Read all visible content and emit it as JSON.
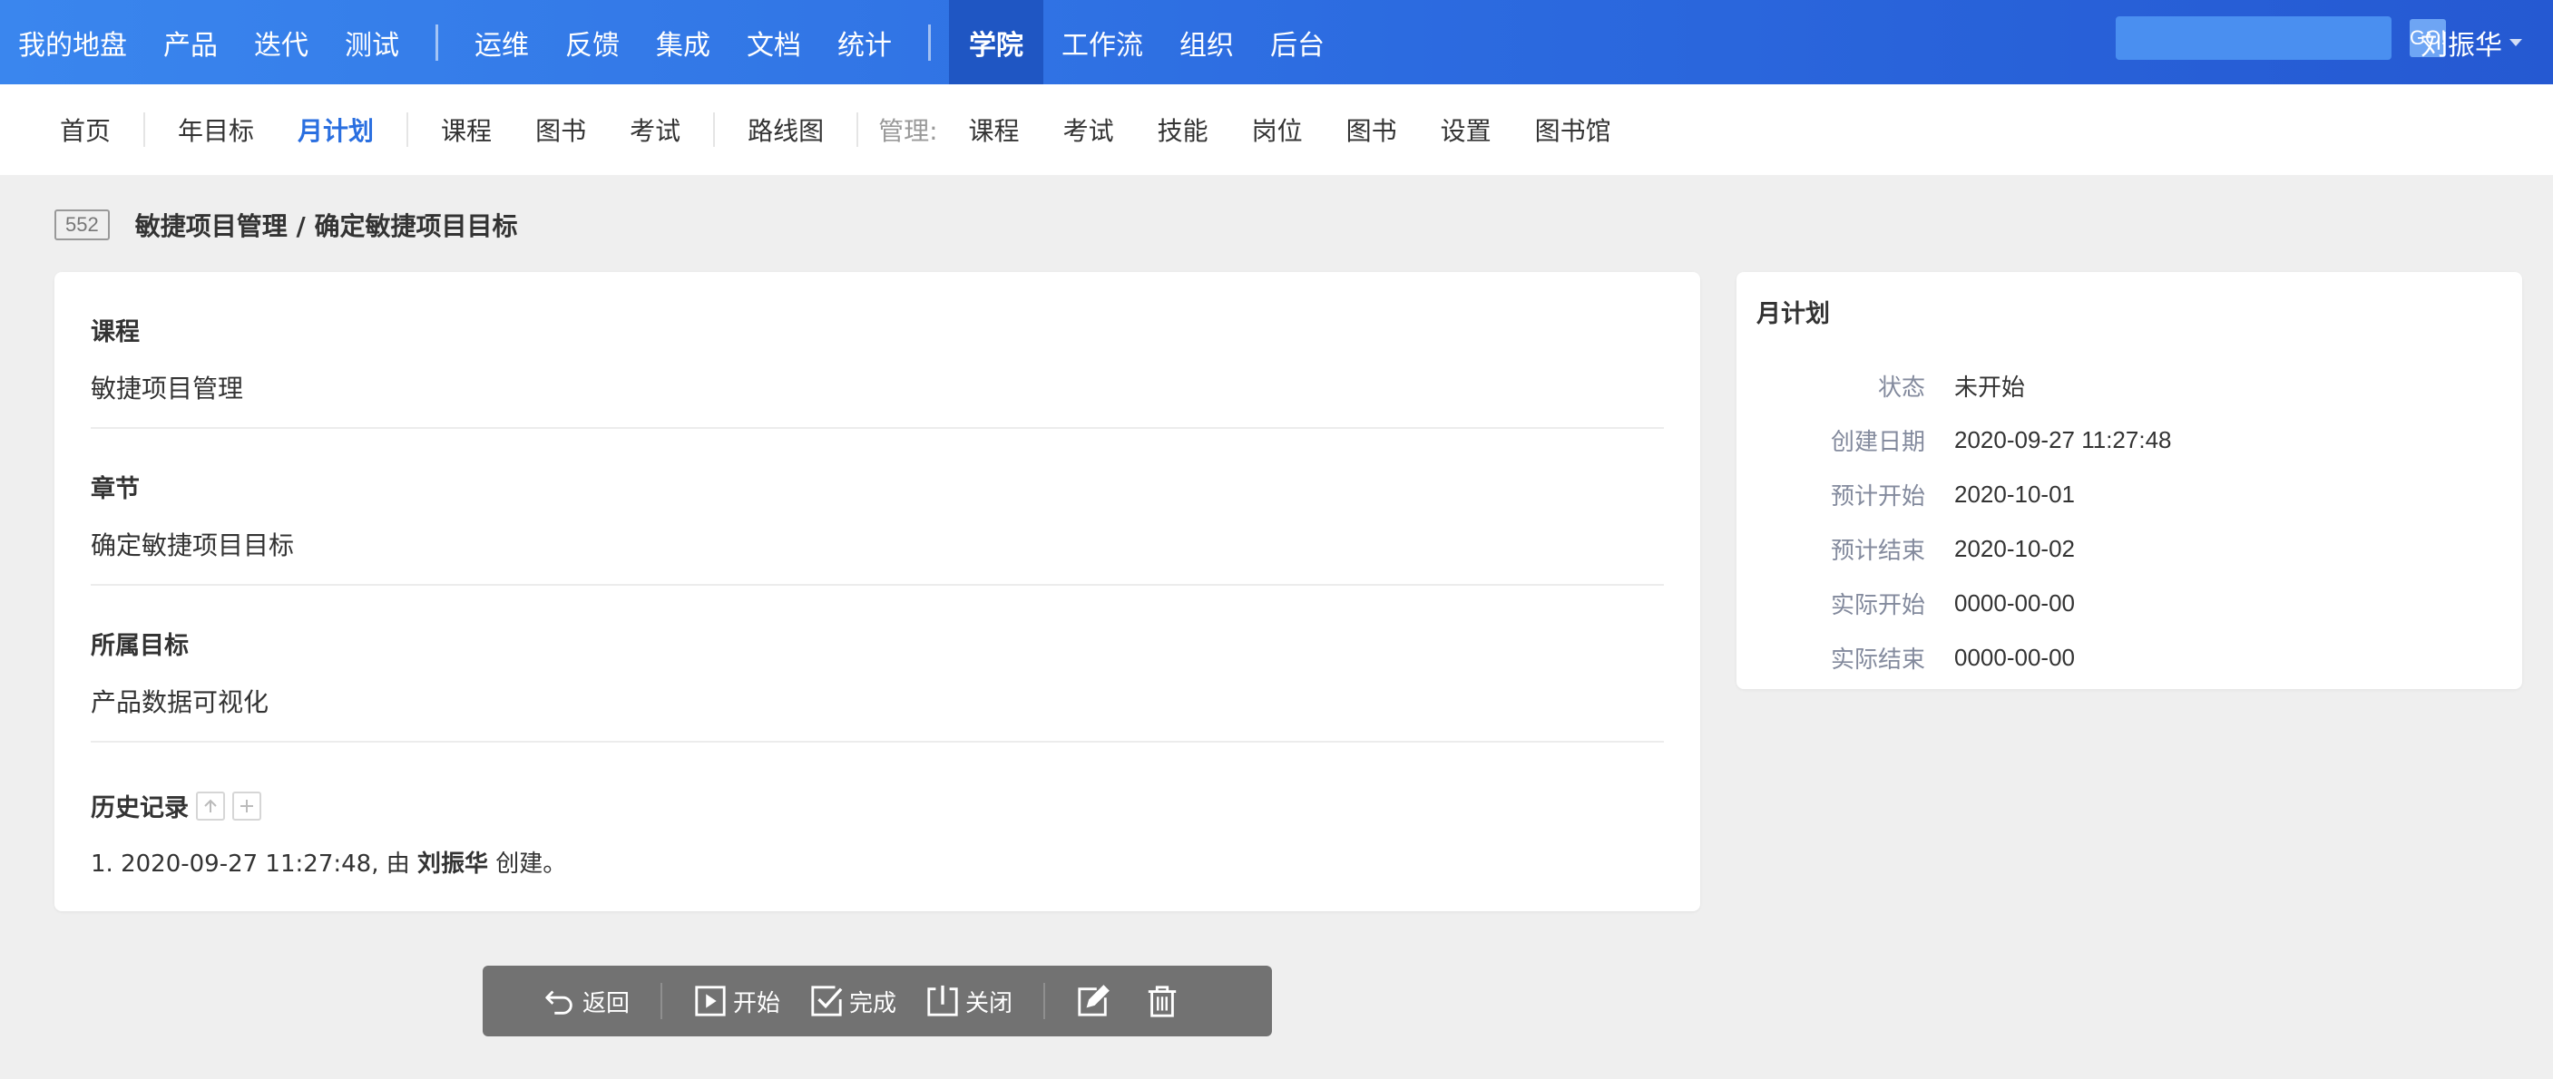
{
  "topnav": {
    "group1": [
      "我的地盘",
      "产品",
      "迭代",
      "测试"
    ],
    "group2": [
      "运维",
      "反馈",
      "集成",
      "文档",
      "统计"
    ],
    "group3": [
      "学院",
      "工作流",
      "组织",
      "后台"
    ],
    "active": "学院",
    "search": {
      "value": "",
      "go_label": "GO!"
    },
    "user": "刘振华"
  },
  "subnav": {
    "items": [
      "首页",
      "年目标",
      "月计划",
      "课程",
      "图书",
      "考试",
      "路线图"
    ],
    "active": "月计划",
    "manage_label": "管理:",
    "manage_items": [
      "课程",
      "考试",
      "技能",
      "岗位",
      "图书",
      "设置",
      "图书馆"
    ]
  },
  "header": {
    "id": "552",
    "title": "敏捷项目管理 / 确定敏捷项目目标"
  },
  "main": {
    "fields": [
      {
        "label": "课程",
        "value": "敏捷项目管理"
      },
      {
        "label": "章节",
        "value": "确定敏捷项目目标"
      },
      {
        "label": "所属目标",
        "value": "产品数据可视化"
      }
    ],
    "history": {
      "label": "历史记录",
      "entries": [
        {
          "prefix": "1. 2020-09-27 11:27:48, 由 ",
          "user": "刘振华",
          "suffix": " 创建。"
        }
      ]
    }
  },
  "side": {
    "title": "月计划",
    "rows": [
      {
        "key": "状态",
        "value": "未开始"
      },
      {
        "key": "创建日期",
        "value": "2020-09-27 11:27:48"
      },
      {
        "key": "预计开始",
        "value": "2020-10-01"
      },
      {
        "key": "预计结束",
        "value": "2020-10-02"
      },
      {
        "key": "实际开始",
        "value": "0000-00-00"
      },
      {
        "key": "实际结束",
        "value": "0000-00-00"
      }
    ]
  },
  "actions": {
    "back": "返回",
    "start": "开始",
    "finish": "完成",
    "close": "关闭",
    "edit_icon": "edit-icon",
    "delete_icon": "trash-icon"
  },
  "colors": {
    "topbar_start": "#3a86ee",
    "topbar_end": "#2559d2",
    "active_tab": "#1f56c3",
    "subnav_active": "#2a6fe0",
    "toolbar_bg": "#727272"
  }
}
